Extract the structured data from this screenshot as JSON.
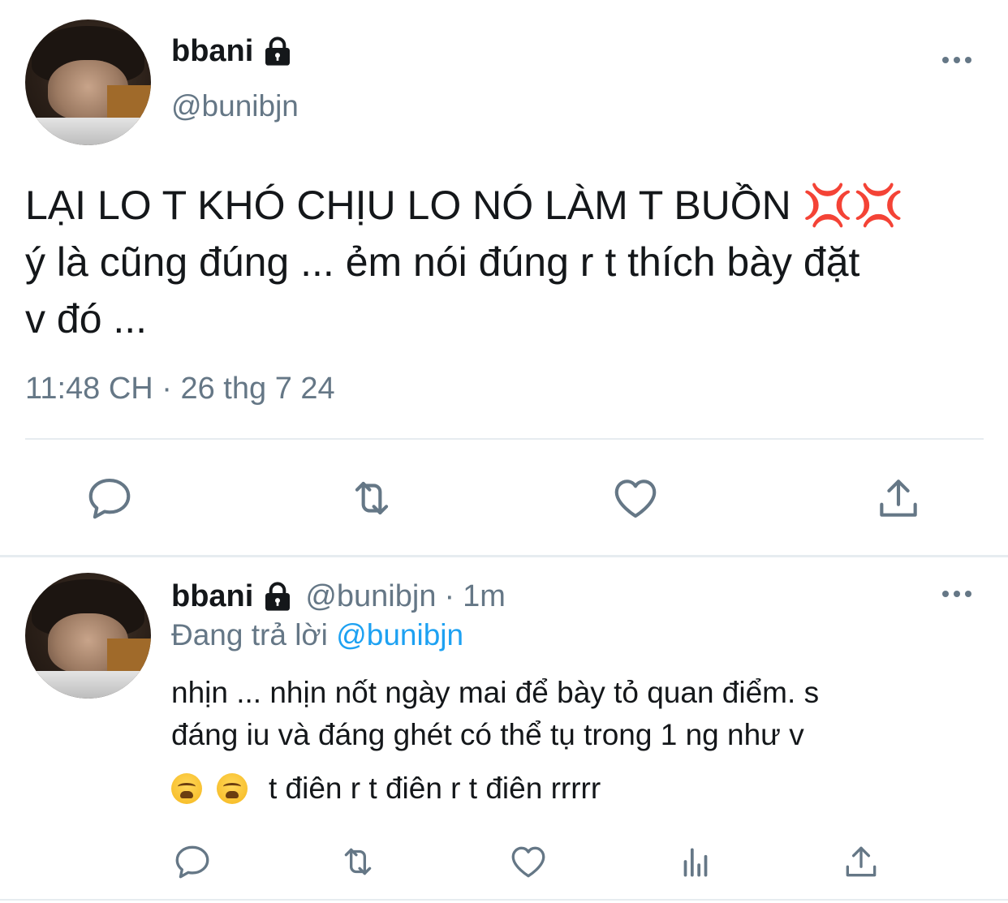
{
  "main_tweet": {
    "display_name": "bbani",
    "handle": "@bunibjn",
    "text_lines": [
      "LẠI LO T KHÓ CHỊU LO NÓ LÀM T BUỒN",
      "ý là cũng đúng ... ẻm nói đúng r t thích bày đặt",
      "v đó ..."
    ],
    "anger_emoji": "💢💢",
    "timestamp": "11:48 CH · 26 thg 7 24",
    "icons": [
      "lock-icon",
      "more-icon",
      "reply-icon",
      "retweet-icon",
      "like-icon",
      "share-icon"
    ]
  },
  "reply_tweet": {
    "display_name": "bbani",
    "handle": "@bunibjn",
    "separator": "·",
    "time_ago": "1m",
    "replying_prefix": "Đang trả lời",
    "replying_to": "@bunibjn",
    "text_lines": [
      "nhịn ... nhịn nốt ngày mai để bày tỏ quan điểm. s",
      "đáng iu và đáng ghét có thể tụ trong 1 ng như v",
      "t điên r t điên r t điên rrrrr"
    ],
    "emoji_names": [
      "tired-face-emoji",
      "tired-face-emoji"
    ],
    "icons": [
      "lock-icon",
      "more-icon",
      "reply-icon",
      "retweet-icon",
      "like-icon",
      "analytics-icon",
      "share-icon"
    ]
  },
  "colors": {
    "text": "#14171a",
    "secondary": "#657786",
    "link": "#1da1f2",
    "divider": "#e6ecf0",
    "icon": "#657786",
    "anger": "#e0245e"
  }
}
